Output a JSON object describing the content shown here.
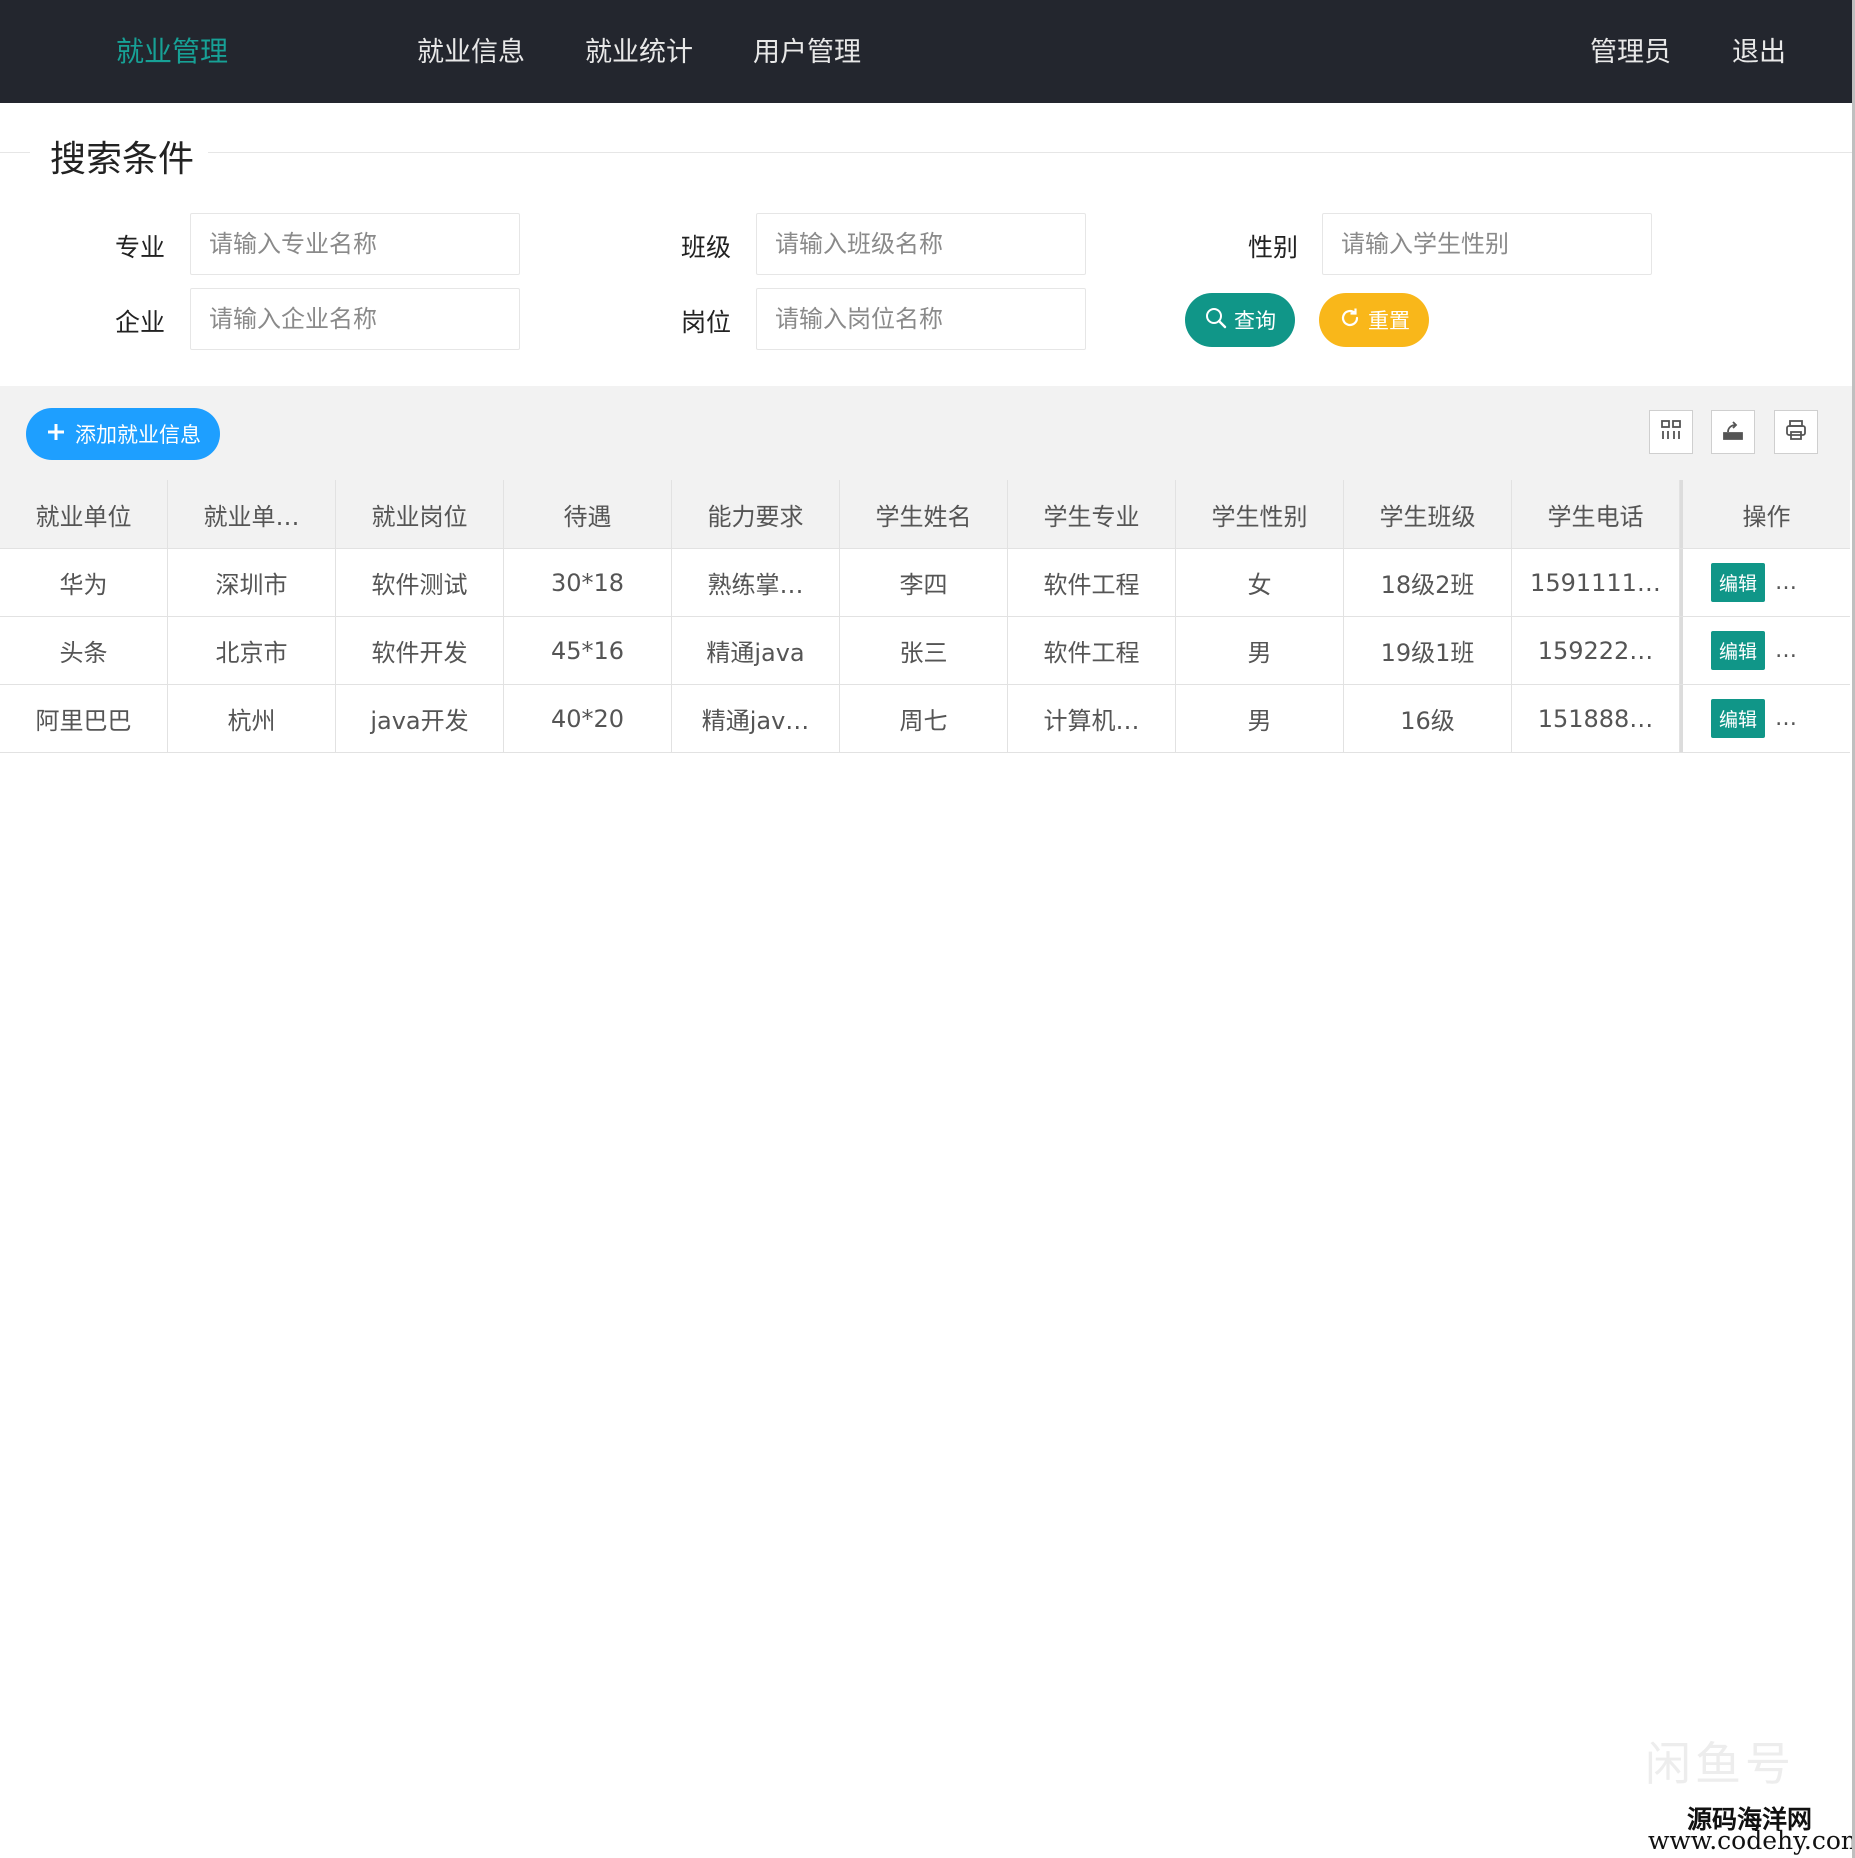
{
  "nav": {
    "brand": "就业管理",
    "links": [
      "就业信息",
      "就业统计",
      "用户管理"
    ],
    "user": "管理员",
    "logout": "退出"
  },
  "search": {
    "legend": "搜索条件",
    "fields": [
      {
        "label": "专业",
        "placeholder": "请输入专业名称",
        "value": ""
      },
      {
        "label": "班级",
        "placeholder": "请输入班级名称",
        "value": ""
      },
      {
        "label": "性别",
        "placeholder": "请输入学生性别",
        "value": ""
      },
      {
        "label": "企业",
        "placeholder": "请输入企业名称",
        "value": ""
      },
      {
        "label": "岗位",
        "placeholder": "请输入岗位名称",
        "value": ""
      }
    ],
    "query_label": "查询",
    "reset_label": "重置"
  },
  "toolbar": {
    "add_label": "添加就业信息",
    "icons": [
      "columns-icon",
      "export-icon",
      "print-icon"
    ]
  },
  "table": {
    "headers": [
      "就业单位",
      "就业单…",
      "就业岗位",
      "待遇",
      "能力要求",
      "学生姓名",
      "学生专业",
      "学生性别",
      "学生班级",
      "学生电话",
      "操作"
    ],
    "rows": [
      [
        "华为",
        "深圳市",
        "软件测试",
        "30*18",
        "熟练掌…",
        "李四",
        "软件工程",
        "女",
        "18级2班",
        "1591111…"
      ],
      [
        "头条",
        "北京市",
        "软件开发",
        "45*16",
        "精通java",
        "张三",
        "软件工程",
        "男",
        "19级1班",
        "159222…"
      ],
      [
        "阿里巴巴",
        "杭州",
        "java开发",
        "40*20",
        "精通jav…",
        "周七",
        "计算机…",
        "男",
        "16级",
        "151888…"
      ]
    ],
    "edit_label": "编辑",
    "more_label": "…"
  },
  "watermark": {
    "faint": "闲鱼号",
    "site_name": "源码海洋网",
    "site_url": "www.codehy.com"
  },
  "colors": {
    "nav_bg": "#23262e",
    "brand": "#17a196",
    "primary": "#109688",
    "warn": "#f9b71a",
    "blue": "#1e9fff"
  }
}
